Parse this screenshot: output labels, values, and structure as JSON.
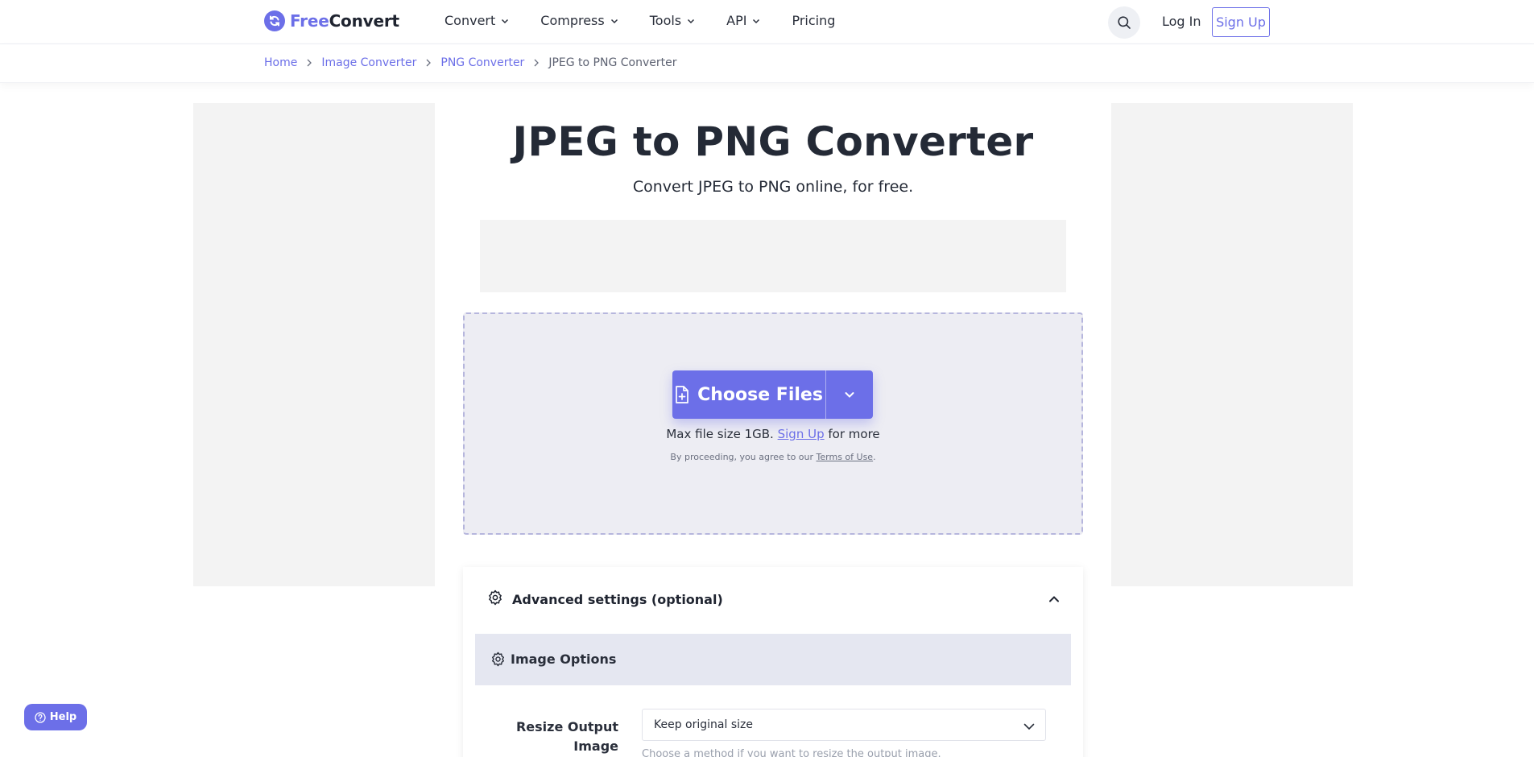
{
  "header": {
    "logo_free": "Free",
    "logo_convert": "Convert",
    "nav": [
      {
        "label": "Convert"
      },
      {
        "label": "Compress"
      },
      {
        "label": "Tools"
      },
      {
        "label": "API"
      },
      {
        "label": "Pricing"
      }
    ],
    "login": "Log In",
    "signup": "Sign Up"
  },
  "breadcrumb": {
    "items": [
      "Home",
      "Image Converter",
      "PNG Converter"
    ],
    "current": "JPEG to PNG Converter"
  },
  "main": {
    "title": "JPEG to PNG Converter",
    "subtitle": "Convert JPEG to PNG online, for free."
  },
  "upload": {
    "choose_label": "Choose Files",
    "max_prefix": "Max file size 1GB.",
    "max_link": "Sign Up",
    "max_suffix": "for more",
    "terms_prefix": "By proceeding, you agree to our",
    "terms_link": "Terms of Use",
    "terms_suffix": "."
  },
  "advanced": {
    "title": "Advanced settings (optional)",
    "section_title": "Image Options",
    "resize_label": "Resize Output Image",
    "resize_value": "Keep original size",
    "resize_hint": "Choose a method if you want to resize the output image."
  },
  "help": {
    "label": "Help"
  },
  "colors": {
    "accent": "#6c6fe8",
    "dropzone_bg": "#ededf3",
    "ad_placeholder": "#f3f3f3"
  }
}
